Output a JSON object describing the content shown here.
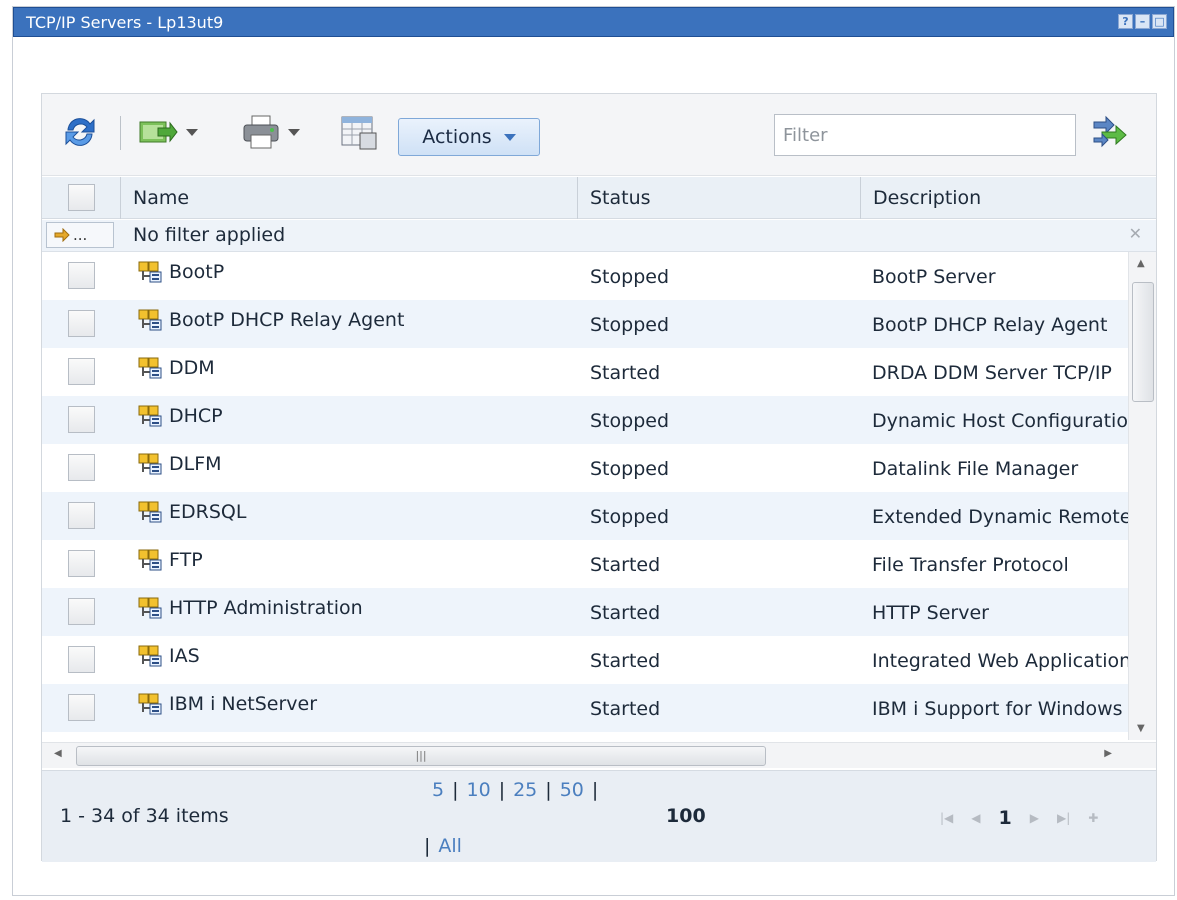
{
  "window": {
    "title": "TCP/IP Servers - Lp13ut9",
    "controls": [
      "?",
      "–",
      "□"
    ]
  },
  "toolbar": {
    "actions_label": "Actions",
    "filter_placeholder": "Filter",
    "icons": [
      "refresh-icon",
      "export-icon",
      "print-icon",
      "table-config-icon",
      "apply-filter-icon"
    ]
  },
  "grid": {
    "columns": [
      "Name",
      "Status",
      "Description"
    ],
    "filter_status": "No filter applied",
    "filter_button": "...",
    "rows": [
      {
        "name": "BootP",
        "status": "Stopped",
        "description": "BootP Server"
      },
      {
        "name": "BootP DHCP Relay Agent",
        "status": "Stopped",
        "description": "BootP DHCP Relay Agent"
      },
      {
        "name": "DDM",
        "status": "Started",
        "description": "DRDA DDM Server TCP/IP"
      },
      {
        "name": "DHCP",
        "status": "Stopped",
        "description": "Dynamic Host Configuration"
      },
      {
        "name": "DLFM",
        "status": "Stopped",
        "description": "Datalink File Manager"
      },
      {
        "name": "EDRSQL",
        "status": "Stopped",
        "description": "Extended Dynamic Remote"
      },
      {
        "name": "FTP",
        "status": "Started",
        "description": "File Transfer Protocol"
      },
      {
        "name": "HTTP Administration",
        "status": "Started",
        "description": "HTTP Server"
      },
      {
        "name": "IAS",
        "status": "Started",
        "description": "Integrated Web Application"
      },
      {
        "name": "IBM i NetServer",
        "status": "Started",
        "description": "IBM i Support for Windows"
      }
    ]
  },
  "footer": {
    "item_count": "1 - 34 of 34 items",
    "page_sizes": [
      "5",
      "10",
      "25",
      "50"
    ],
    "current_page_size": "100",
    "all_label": "All",
    "current_page": "1"
  },
  "colors": {
    "titlebar": "#3b72bd",
    "link": "#4b7fbf",
    "row_alt": "#eef4fb"
  }
}
